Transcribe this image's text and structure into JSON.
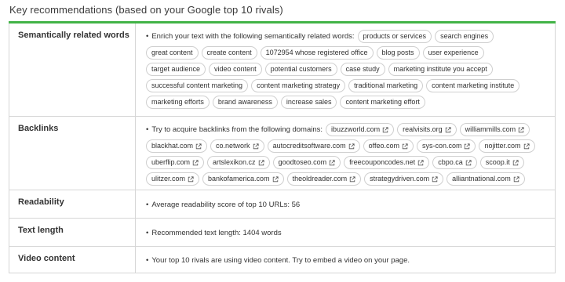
{
  "page": {
    "title": "Key recommendations (based on your Google top 10 rivals)"
  },
  "rows": {
    "semantic": {
      "label": "Semantically related words",
      "intro": "Enrich your text with the following semantically related words:",
      "chips": [
        "products or services",
        "search engines",
        "great content",
        "create content",
        "1072954 whose registered office",
        "blog posts",
        "user experience",
        "target audience",
        "video content",
        "potential customers",
        "case study",
        "marketing institute you accept",
        "successful content marketing",
        "content marketing strategy",
        "traditional marketing",
        "content marketing institute",
        "marketing efforts",
        "brand awareness",
        "increase sales",
        "content marketing effort"
      ]
    },
    "backlinks": {
      "label": "Backlinks",
      "intro": "Try to acquire backlinks from the following domains:",
      "domains": [
        "ibuzzworld.com",
        "realvisits.org",
        "williammills.com",
        "blackhat.com",
        "co.network",
        "autocreditsoftware.com",
        "offeo.com",
        "sys-con.com",
        "nojitter.com",
        "uberflip.com",
        "artslexikon.cz",
        "goodtoseo.com",
        "freecouponcodes.net",
        "cbpo.ca",
        "scoop.it",
        "ulitzer.com",
        "bankofamerica.com",
        "theoldreader.com",
        "strategydriven.com",
        "alliantnational.com"
      ]
    },
    "readability": {
      "label": "Readability",
      "text": "Average readability score of top 10 URLs:  56"
    },
    "text_length": {
      "label": "Text length",
      "text": "Recommended text length:  1404 words"
    },
    "video": {
      "label": "Video content",
      "text": "Your top 10 rivals are using video content. Try to embed a video on your page."
    }
  },
  "icons": {
    "external": "external-link-icon",
    "bullet": "•"
  },
  "colors": {
    "accent": "#42b347",
    "border": "#d6d6d6"
  }
}
